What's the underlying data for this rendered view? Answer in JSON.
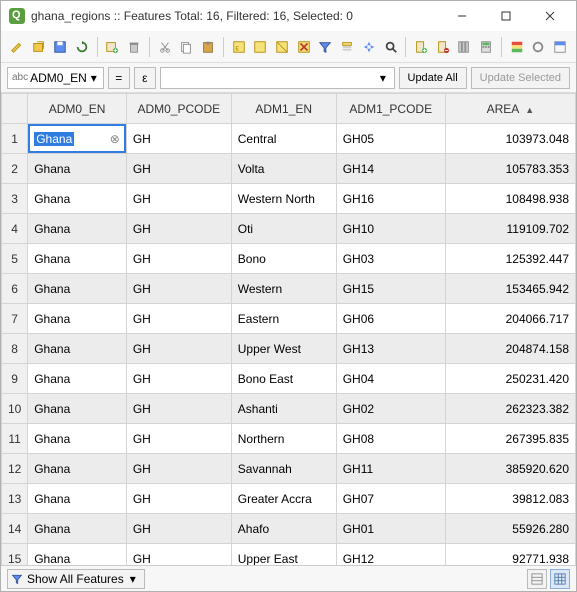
{
  "title": "ghana_regions :: Features Total: 16, Filtered: 16, Selected: 0",
  "fieldbar": {
    "field": "ADM0_EN",
    "eq": "=",
    "eps": "ε",
    "update_all": "Update All",
    "update_sel": "Update Selected"
  },
  "columns": [
    "ADM0_EN",
    "ADM0_PCODE",
    "ADM1_EN",
    "ADM1_PCODE",
    "AREA"
  ],
  "sorted_col": 4,
  "edit_cell": {
    "row": 0,
    "col": 0,
    "value": "Ghana"
  },
  "rows": [
    {
      "n": "1",
      "ADM0_EN": "Ghana",
      "ADM0_PCODE": "GH",
      "ADM1_EN": "Central",
      "ADM1_PCODE": "GH05",
      "AREA": "103973.048"
    },
    {
      "n": "2",
      "ADM0_EN": "Ghana",
      "ADM0_PCODE": "GH",
      "ADM1_EN": "Volta",
      "ADM1_PCODE": "GH14",
      "AREA": "105783.353"
    },
    {
      "n": "3",
      "ADM0_EN": "Ghana",
      "ADM0_PCODE": "GH",
      "ADM1_EN": "Western North",
      "ADM1_PCODE": "GH16",
      "AREA": "108498.938"
    },
    {
      "n": "4",
      "ADM0_EN": "Ghana",
      "ADM0_PCODE": "GH",
      "ADM1_EN": "Oti",
      "ADM1_PCODE": "GH10",
      "AREA": "119109.702"
    },
    {
      "n": "5",
      "ADM0_EN": "Ghana",
      "ADM0_PCODE": "GH",
      "ADM1_EN": "Bono",
      "ADM1_PCODE": "GH03",
      "AREA": "125392.447"
    },
    {
      "n": "6",
      "ADM0_EN": "Ghana",
      "ADM0_PCODE": "GH",
      "ADM1_EN": "Western",
      "ADM1_PCODE": "GH15",
      "AREA": "153465.942"
    },
    {
      "n": "7",
      "ADM0_EN": "Ghana",
      "ADM0_PCODE": "GH",
      "ADM1_EN": "Eastern",
      "ADM1_PCODE": "GH06",
      "AREA": "204066.717"
    },
    {
      "n": "8",
      "ADM0_EN": "Ghana",
      "ADM0_PCODE": "GH",
      "ADM1_EN": "Upper West",
      "ADM1_PCODE": "GH13",
      "AREA": "204874.158"
    },
    {
      "n": "9",
      "ADM0_EN": "Ghana",
      "ADM0_PCODE": "GH",
      "ADM1_EN": "Bono East",
      "ADM1_PCODE": "GH04",
      "AREA": "250231.420"
    },
    {
      "n": "10",
      "ADM0_EN": "Ghana",
      "ADM0_PCODE": "GH",
      "ADM1_EN": "Ashanti",
      "ADM1_PCODE": "GH02",
      "AREA": "262323.382"
    },
    {
      "n": "11",
      "ADM0_EN": "Ghana",
      "ADM0_PCODE": "GH",
      "ADM1_EN": "Northern",
      "ADM1_PCODE": "GH08",
      "AREA": "267395.835"
    },
    {
      "n": "12",
      "ADM0_EN": "Ghana",
      "ADM0_PCODE": "GH",
      "ADM1_EN": "Savannah",
      "ADM1_PCODE": "GH11",
      "AREA": "385920.620"
    },
    {
      "n": "13",
      "ADM0_EN": "Ghana",
      "ADM0_PCODE": "GH",
      "ADM1_EN": "Greater Accra",
      "ADM1_PCODE": "GH07",
      "AREA": "39812.083"
    },
    {
      "n": "14",
      "ADM0_EN": "Ghana",
      "ADM0_PCODE": "GH",
      "ADM1_EN": "Ahafo",
      "ADM1_PCODE": "GH01",
      "AREA": "55926.280"
    },
    {
      "n": "15",
      "ADM0_EN": "Ghana",
      "ADM0_PCODE": "GH",
      "ADM1_EN": "Upper East",
      "ADM1_PCODE": "GH12",
      "AREA": "92771.938"
    }
  ],
  "status": {
    "filter": "Show All Features"
  }
}
